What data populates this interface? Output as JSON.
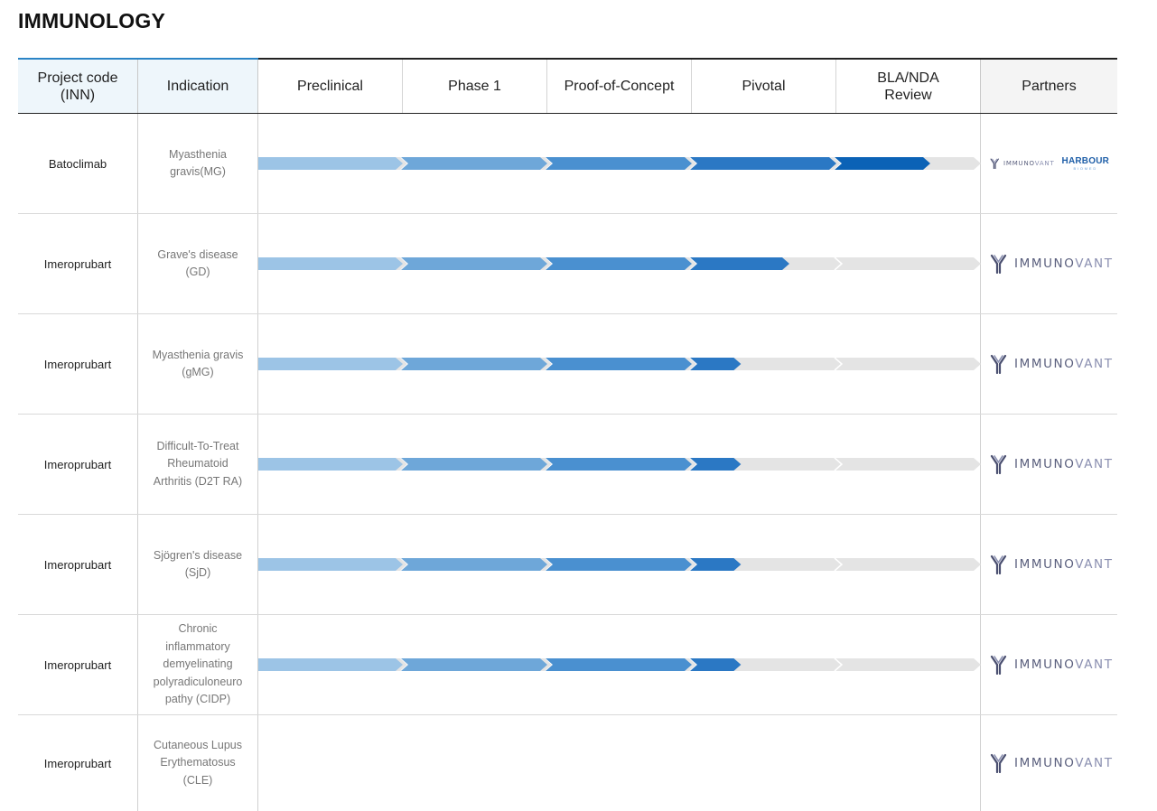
{
  "title": "IMMUNOLOGY",
  "header": {
    "project_code": "Project code\n(INN)",
    "indication": "Indication",
    "stages": [
      "Preclinical",
      "Phase 1",
      "Proof-of-Concept",
      "Pivotal",
      "BLA/NDA\nReview"
    ],
    "partners": "Partners"
  },
  "colors": {
    "accent": "#2b84c6",
    "stage_fills": [
      "#9cc4e6",
      "#6ea7d9",
      "#4a90d0",
      "#2b78c4",
      "#0b62b6"
    ],
    "track": "#e4e4e4"
  },
  "rows": [
    {
      "code": "Batoclimab",
      "indication": "Myasthenia\ngravis(MG)",
      "progress": 0.93,
      "partners": [
        "Immunovant",
        "Harbour BioMed"
      ]
    },
    {
      "code": "Imeroprubart",
      "indication": "Grave's disease\n(GD)",
      "progress": 0.735,
      "partners": [
        "Immunovant"
      ]
    },
    {
      "code": "Imeroprubart",
      "indication": "Myasthenia gravis\n(gMG)",
      "progress": 0.668,
      "partners": [
        "Immunovant"
      ]
    },
    {
      "code": "Imeroprubart",
      "indication": "Difficult-To-Treat\nRheumatoid\nArthritis (D2T RA)",
      "progress": 0.668,
      "partners": [
        "Immunovant"
      ]
    },
    {
      "code": "Imeroprubart",
      "indication": "Sjögren's disease\n(SjD)",
      "progress": 0.668,
      "partners": [
        "Immunovant"
      ]
    },
    {
      "code": "Imeroprubart",
      "indication": "Chronic\ninflammatory\ndemyelinating\npolyradiculoneuro\npathy (CIDP)",
      "progress": 0.668,
      "partners": [
        "Immunovant"
      ]
    },
    {
      "code": "Imeroprubart",
      "indication": "Cutaneous Lupus\nErythematosus\n(CLE)",
      "progress": 0,
      "partners": [
        "Immunovant"
      ]
    }
  ],
  "partner_logos": {
    "immunovant_a": "IMMUNO",
    "immunovant_b": "VANT",
    "harbour_main": "HARBOUR",
    "harbour_sub": "BIOMED"
  }
}
